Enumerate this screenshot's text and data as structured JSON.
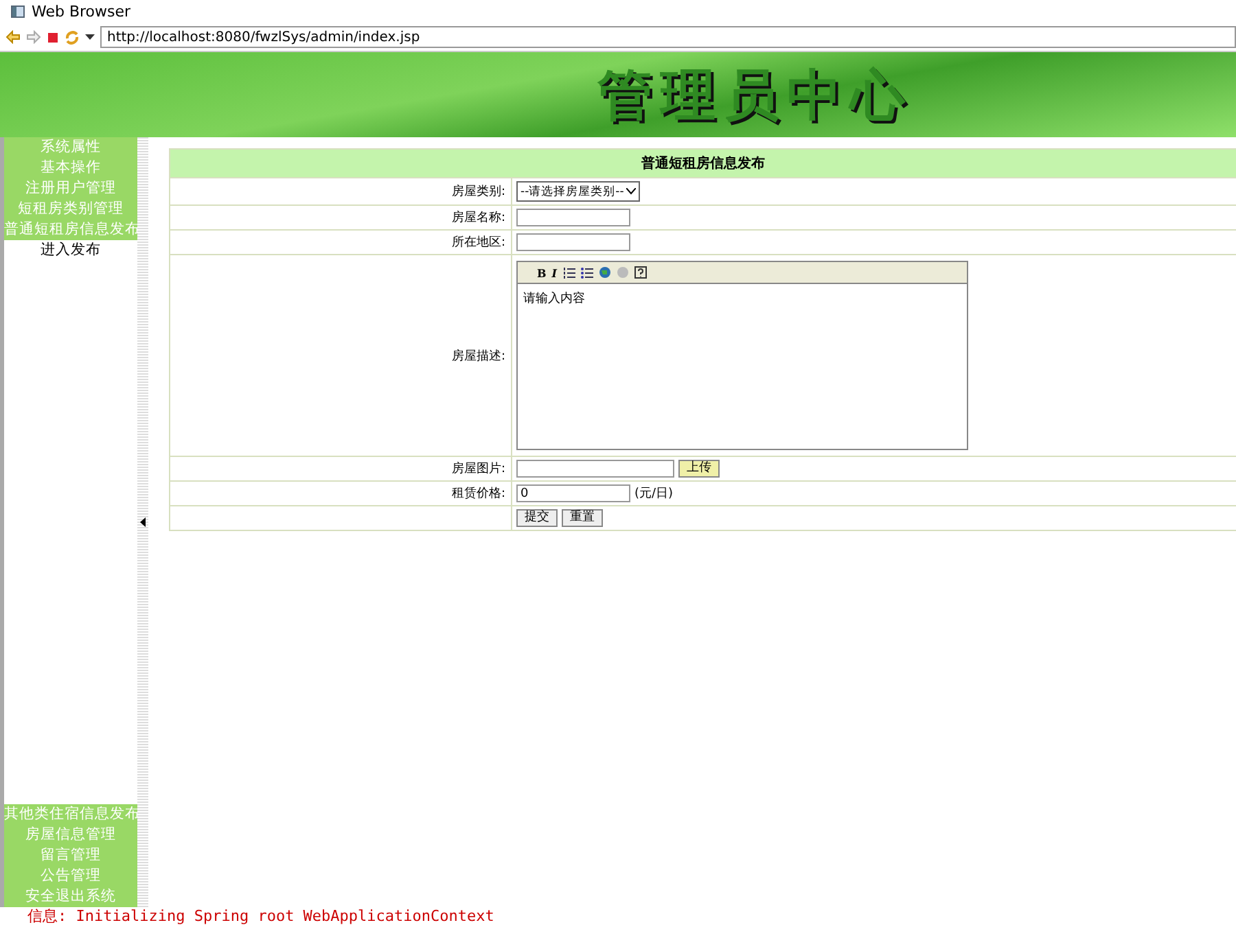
{
  "window": {
    "title": "Web Browser"
  },
  "address_bar": {
    "value": "http://localhost:8080/fwzlSys/admin/index.jsp"
  },
  "banner": {
    "title": "管理员中心"
  },
  "sidebar": {
    "top_items": [
      {
        "label": "系统属性",
        "kind": "header"
      },
      {
        "label": "基本操作",
        "kind": "header"
      },
      {
        "label": "注册用户管理",
        "kind": "header"
      },
      {
        "label": "短租房类别管理",
        "kind": "header"
      },
      {
        "label": "普通短租房信息发布",
        "kind": "header"
      },
      {
        "label": "进入发布",
        "kind": "link"
      }
    ],
    "bottom_items": [
      {
        "label": "其他类住宿信息发布",
        "kind": "header"
      },
      {
        "label": "房屋信息管理",
        "kind": "header"
      },
      {
        "label": "留言管理",
        "kind": "header"
      },
      {
        "label": "公告管理",
        "kind": "header"
      },
      {
        "label": "安全退出系统",
        "kind": "header"
      }
    ]
  },
  "form": {
    "title": "普通短租房信息发布",
    "rows": [
      {
        "label": "房屋类别:",
        "kind": "select",
        "value": "--请选择房屋类别--"
      },
      {
        "label": "房屋名称:",
        "kind": "text",
        "value": ""
      },
      {
        "label": "所在地区:",
        "kind": "text",
        "value": ""
      },
      {
        "label": "房屋描述:",
        "kind": "editor",
        "value": "请输入内容",
        "tools": [
          "B",
          "I"
        ]
      },
      {
        "label": "房屋图片:",
        "kind": "file",
        "value": "",
        "button": "上传"
      },
      {
        "label": "租赁价格:",
        "kind": "price",
        "value": "0",
        "unit": "(元/日)"
      },
      {
        "label": "",
        "kind": "buttons",
        "buttons": [
          "提交",
          "重置"
        ]
      }
    ]
  },
  "console": {
    "text": "信息: Initializing Spring root WebApplicationContext"
  }
}
